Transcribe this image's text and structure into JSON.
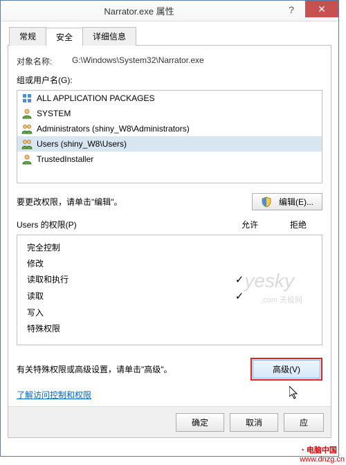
{
  "titlebar": {
    "title": "Narrator.exe 属性"
  },
  "tabs": {
    "general": "常规",
    "security": "安全",
    "details": "详细信息",
    "active": "security"
  },
  "object": {
    "label": "对象名称:",
    "value": "G:\\Windows\\System32\\Narrator.exe"
  },
  "groups": {
    "label": "组或用户名(G):",
    "items": [
      {
        "name": "ALL APPLICATION PACKAGES",
        "icon": "pkg",
        "selected": false
      },
      {
        "name": "SYSTEM",
        "icon": "user",
        "selected": false
      },
      {
        "name": "Administrators (shiny_W8\\Administrators)",
        "icon": "users",
        "selected": false
      },
      {
        "name": "Users (shiny_W8\\Users)",
        "icon": "users",
        "selected": true
      },
      {
        "name": "TrustedInstaller",
        "icon": "user",
        "selected": false
      }
    ]
  },
  "edit": {
    "text": "要更改权限，请单击\"编辑\"。",
    "button": "编辑(E)..."
  },
  "perms": {
    "header_label": "Users 的权限(P)",
    "col_allow": "允许",
    "col_deny": "拒绝",
    "rows": [
      {
        "name": "完全控制",
        "allow": false,
        "deny": false
      },
      {
        "name": "修改",
        "allow": false,
        "deny": false
      },
      {
        "name": "读取和执行",
        "allow": true,
        "deny": false
      },
      {
        "name": "读取",
        "allow": true,
        "deny": false
      },
      {
        "name": "写入",
        "allow": false,
        "deny": false
      },
      {
        "name": "特殊权限",
        "allow": false,
        "deny": false
      }
    ]
  },
  "advanced": {
    "text": "有关特殊权限或高级设置，请单击\"高级\"。",
    "button": "高级(V)"
  },
  "link": "了解访问控制和权限",
  "footer": {
    "ok": "确定",
    "cancel": "取消",
    "apply": "应"
  },
  "watermark": {
    "text": "yesky",
    "sub": ".com  天极网"
  },
  "site_badge": {
    "cn": "电脑中国",
    "url": "www.dnzg.cn"
  }
}
